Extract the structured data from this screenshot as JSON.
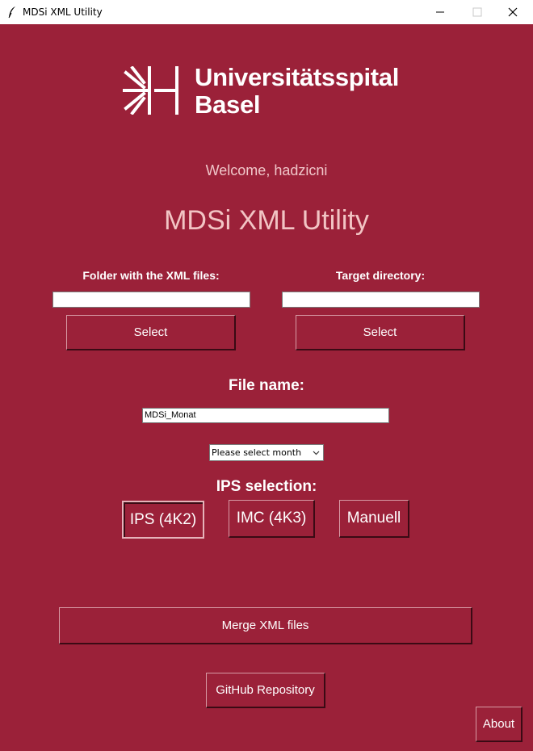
{
  "window": {
    "title": "MDSi XML Utility"
  },
  "logo": {
    "line1": "Universitätsspital",
    "line2": "Basel"
  },
  "welcome": "Welcome, hadzicni",
  "app_title": "MDSi XML Utility",
  "source": {
    "label": "Folder with the XML files:",
    "value": "",
    "button": "Select"
  },
  "target": {
    "label": "Target directory:",
    "value": "",
    "button": "Select"
  },
  "filename": {
    "label": "File name:",
    "value": "MDSi_Monat"
  },
  "month": {
    "selected": "Please select month"
  },
  "ips": {
    "label": "IPS selection:",
    "options": [
      "IPS (4K2)",
      "IMC (4K3)",
      "Manuell"
    ]
  },
  "merge_button": "Merge XML files",
  "github_button": "GitHub Repository",
  "about_button": "About",
  "colors": {
    "background": "#9b2139",
    "accent_text": "#f2c4c4"
  }
}
